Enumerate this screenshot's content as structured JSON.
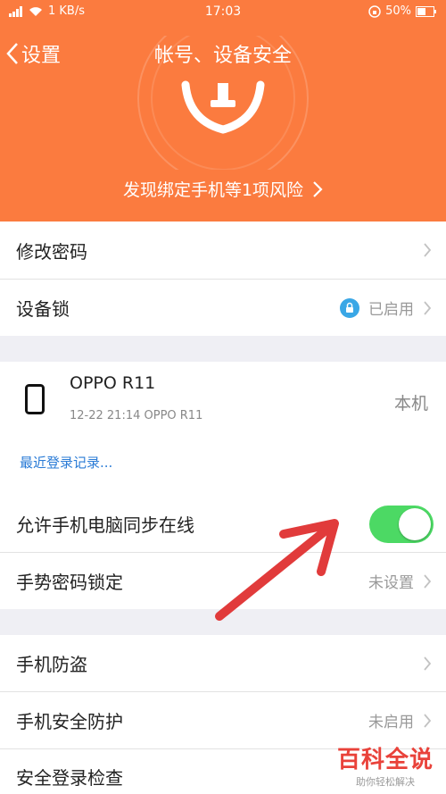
{
  "status_bar": {
    "network_speed": "1 KB/s",
    "time": "17:03",
    "battery": "50%"
  },
  "header": {
    "back_label": "设置",
    "title": "帐号、设备安全",
    "risk_text": "发现绑定手机等1项风险"
  },
  "rows": {
    "change_password": "修改密码",
    "device_lock": "设备锁",
    "device_lock_status": "已启用",
    "sync_online": "允许手机电脑同步在线",
    "gesture_lock": "手势密码锁定",
    "gesture_lock_status": "未设置",
    "anti_theft": "手机防盗",
    "phone_security": "手机安全防护",
    "phone_security_status": "未启用",
    "login_check": "安全登录检查"
  },
  "device": {
    "name": "OPPO R11",
    "meta": "12-22 21:14 OPPO R11",
    "local_label": "本机",
    "recent_login_link": "最近登录记录..."
  },
  "watermark": {
    "big": "百科全说",
    "small": "助你轻松解决"
  },
  "colors": {
    "header_bg": "#fb7b3f",
    "toggle_on": "#4cd964",
    "link": "#2a7bd6",
    "lock_badge": "#3aa7e6",
    "arrow": "#e13b3b"
  },
  "toggle": {
    "sync_online_enabled": true
  }
}
